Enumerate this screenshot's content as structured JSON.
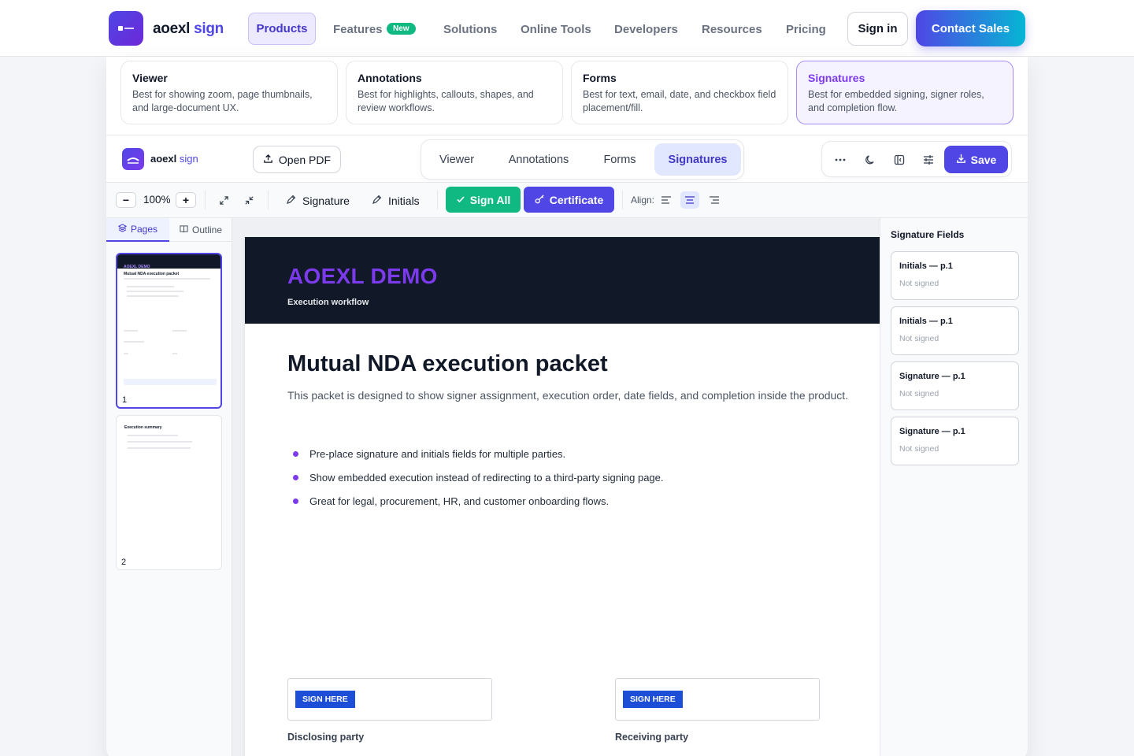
{
  "nav": {
    "brand_a": "aoexl",
    "brand_b": "sign",
    "items": [
      "Products",
      "Features",
      "Solutions",
      "Online Tools",
      "Developers",
      "Resources",
      "Pricing"
    ],
    "new_badge": "New",
    "signin": "Sign in",
    "contact": "Contact Sales"
  },
  "products": [
    {
      "title": "Viewer",
      "desc": "Best for showing zoom, page thumbnails, and large-document UX."
    },
    {
      "title": "Annotations",
      "desc": "Best for highlights, callouts, shapes, and review workflows."
    },
    {
      "title": "Forms",
      "desc": "Best for text, email, date, and checkbox field placement/fill."
    },
    {
      "title": "Signatures",
      "desc": "Best for embedded signing, signer roles, and completion flow."
    }
  ],
  "app": {
    "brand_a": "aoexl",
    "brand_b": "sign",
    "open_pdf": "Open PDF",
    "tabs": [
      "Viewer",
      "Annotations",
      "Forms",
      "Signatures"
    ],
    "save": "Save"
  },
  "toolbar": {
    "zoom_out": "−",
    "zoom": "100%",
    "zoom_in": "+",
    "signature": "Signature",
    "initials": "Initials",
    "sign_all": "Sign All",
    "certificate": "Certificate",
    "align": "Align:"
  },
  "leftpanel": {
    "tabs": [
      "Pages",
      "Outline"
    ],
    "page_numbers": [
      "1",
      "2"
    ],
    "thumb1": {
      "header": "AOEXL DEMO",
      "title": "Mutual NDA execution packet"
    },
    "thumb2": {
      "title": "Execution summary"
    }
  },
  "document": {
    "header_title": "AOEXL DEMO",
    "header_sub": "Execution workflow",
    "title": "Mutual NDA execution packet",
    "intro": "This packet is designed to show signer assignment, execution order, date fields, and completion inside the product.",
    "bullets": [
      "Pre-place signature and initials fields for multiple parties.",
      "Show embedded execution instead of redirecting to a third-party signing page.",
      "Great for legal, procurement, HR, and customer onboarding flows."
    ],
    "sign_here": "SIGN HERE",
    "parties": [
      "Disclosing party",
      "Receiving party"
    ]
  },
  "signature_fields": {
    "title": "Signature Fields",
    "items": [
      {
        "name": "Initials — p.1",
        "status": "Not signed"
      },
      {
        "name": "Initials — p.1",
        "status": "Not signed"
      },
      {
        "name": "Signature — p.1",
        "status": "Not signed"
      },
      {
        "name": "Signature — p.1",
        "status": "Not signed"
      }
    ]
  },
  "colors": {
    "accent": "#4f46e5",
    "purple": "#7c3aed",
    "success": "#10b981",
    "cyan": "#06b6d4",
    "dark": "#111827"
  }
}
